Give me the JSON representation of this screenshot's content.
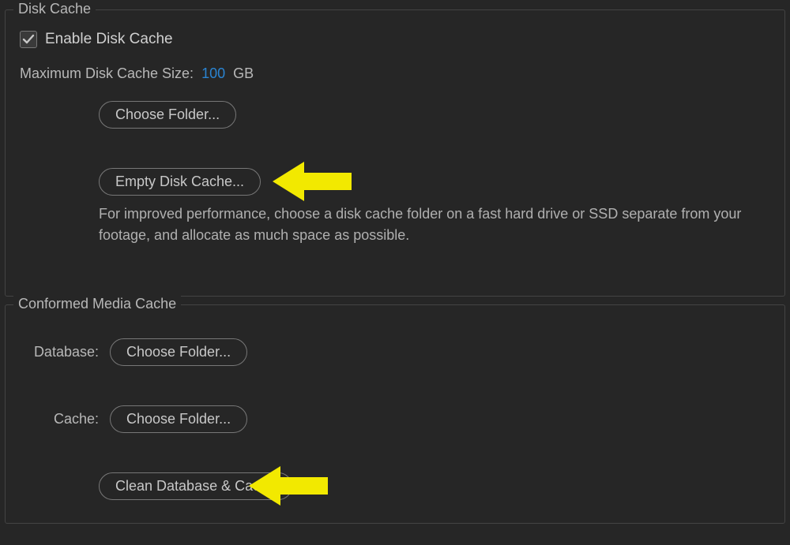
{
  "disk_cache": {
    "title": "Disk Cache",
    "enable_label": "Enable Disk Cache",
    "enable_checked": true,
    "size_label": "Maximum Disk Cache Size:",
    "size_value": "100",
    "size_unit": "GB",
    "choose_folder_label": "Choose Folder...",
    "empty_cache_label": "Empty Disk Cache...",
    "help_text": "For improved performance, choose a disk cache folder on a fast hard drive or SSD separate from your footage, and allocate as much space as possible."
  },
  "conformed_media": {
    "title": "Conformed Media Cache",
    "database_label": "Database:",
    "cache_label": "Cache:",
    "choose_folder_label": "Choose Folder...",
    "clean_label": "Clean Database & Cache"
  }
}
